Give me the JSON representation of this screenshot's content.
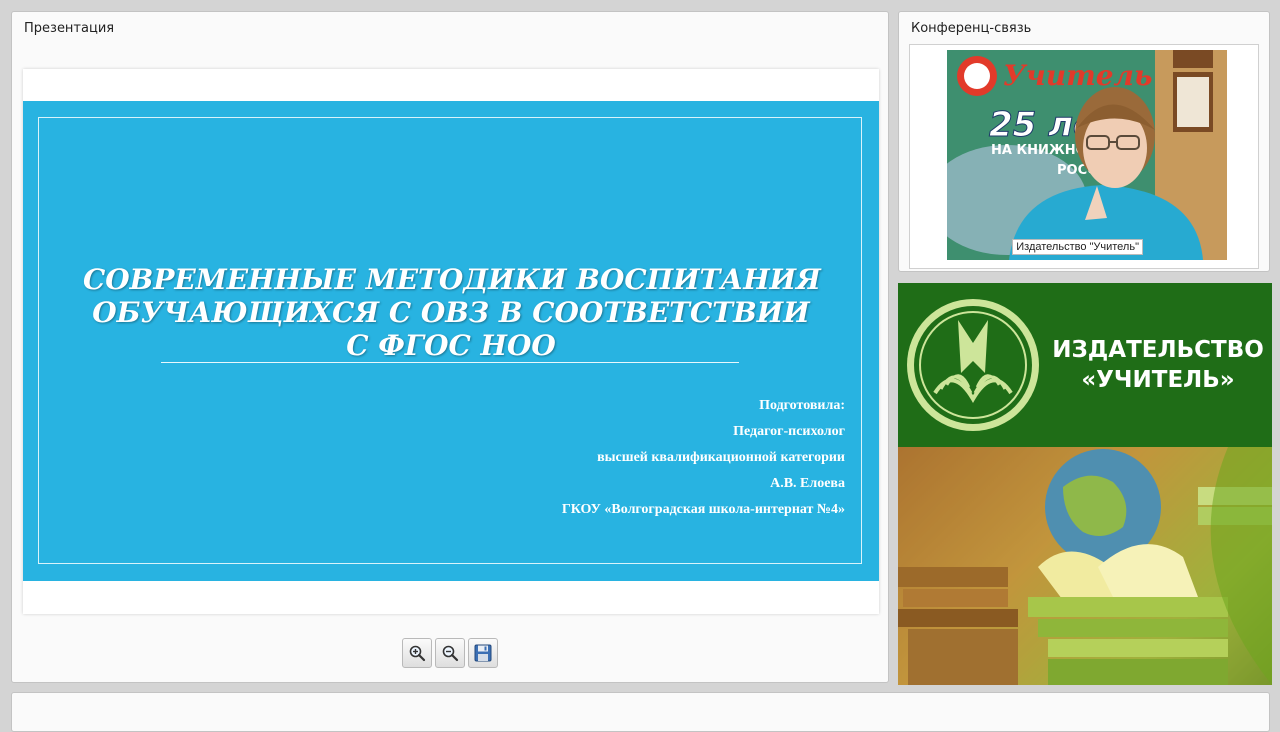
{
  "presentation_panel": {
    "title": "Презентация",
    "slide": {
      "title_lines": [
        "СОВРЕМЕННЫЕ МЕТОДИКИ ВОСПИТАНИЯ",
        "ОБУЧАЮЩИХСЯ С ОВЗ В СООТВЕТСТВИИ",
        "С ФГОС НОО"
      ],
      "author_lines": [
        "Подготовила:",
        "Педагог-психолог",
        "высшей квалификационной категории",
        "А.В. Елоева",
        "ГКОУ «Волгоградская школа-интернат №4»"
      ],
      "background_color": "#28b3e1"
    },
    "toolbar": {
      "buttons": [
        {
          "name": "zoom-in-button",
          "icon": "zoom-in-icon"
        },
        {
          "name": "zoom-out-button",
          "icon": "zoom-out-icon"
        },
        {
          "name": "save-button",
          "icon": "save-icon"
        }
      ]
    }
  },
  "conference_panel": {
    "title": "Конференц-связь",
    "video": {
      "caption": "Издательство \"Учитель\"",
      "banner_text_1": "Учитель",
      "banner_text_2": "25 ле",
      "banner_text_3": "НА КНИЖНОМ",
      "banner_text_4": "РОСС"
    }
  },
  "branding": {
    "line1": "ИЗДАТЕЛЬСТВО",
    "line2": "«УЧИТЕЛЬ»",
    "primary_color": "#1f6d17"
  }
}
